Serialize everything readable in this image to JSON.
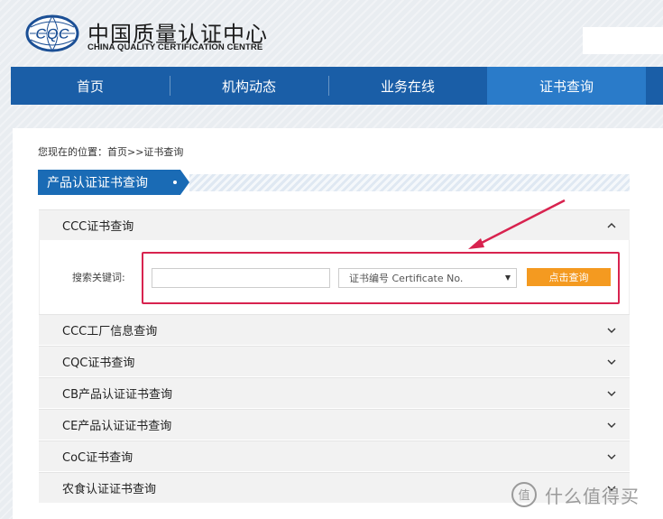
{
  "header": {
    "logo_mark": "CQC",
    "title_cn": "中国质量认证中心",
    "title_en": "CHINA QUALITY CERTIFICATION CENTRE"
  },
  "nav": {
    "items": [
      {
        "label": "首页",
        "active": false
      },
      {
        "label": "机构动态",
        "active": false
      },
      {
        "label": "业务在线",
        "active": false
      },
      {
        "label": "证书查询",
        "active": true
      }
    ]
  },
  "breadcrumb": "您现在的位置：首页>>证书查询",
  "section_title": "产品认证证书查询",
  "accordion": {
    "open": {
      "label": "CCC证书查询",
      "search_label": "搜索关键词:",
      "search_value": "",
      "select_value": "证书编号 Certificate No.",
      "button_label": "点击查询"
    },
    "rows": [
      "CCC工厂信息查询",
      "CQC证书查询",
      "CB产品认证证书查询",
      "CE产品认证证书查询",
      "CoC证书查询",
      "农食认证证书查询"
    ]
  },
  "watermark": {
    "logo": "值",
    "text": "什么值得买"
  },
  "colors": {
    "nav": "#1a5ea7",
    "nav_active": "#2a7bc9",
    "section": "#1a6bb5",
    "button": "#f49a20",
    "highlight": "#d8234f"
  }
}
